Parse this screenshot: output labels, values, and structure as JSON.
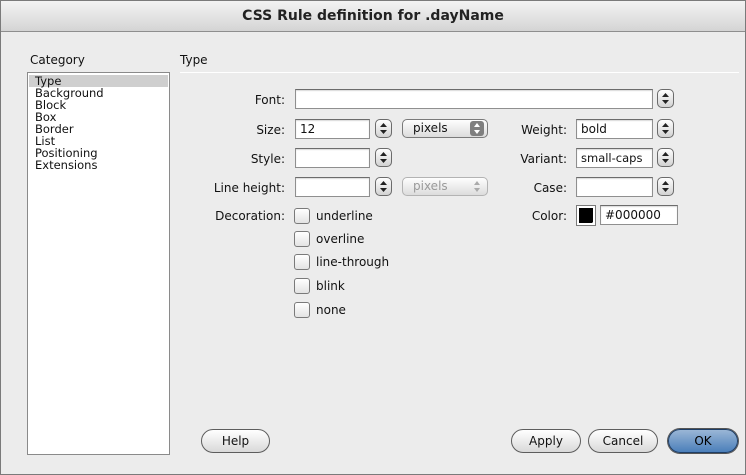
{
  "window": {
    "title": "CSS Rule definition for .dayName"
  },
  "category": {
    "heading": "Category",
    "items": [
      "Type",
      "Background",
      "Block",
      "Box",
      "Border",
      "List",
      "Positioning",
      "Extensions"
    ],
    "selected": "Type"
  },
  "panel": {
    "heading": "Type",
    "font": {
      "label": "Font:",
      "value": ""
    },
    "size": {
      "label": "Size:",
      "value": "12",
      "unit": "pixels"
    },
    "weight": {
      "label": "Weight:",
      "value": "bold"
    },
    "style": {
      "label": "Style:",
      "value": ""
    },
    "variant": {
      "label": "Variant:",
      "value": "small-caps"
    },
    "line_height": {
      "label": "Line height:",
      "value": "",
      "unit": "pixels"
    },
    "case": {
      "label": "Case:",
      "value": ""
    },
    "decoration": {
      "label": "Decoration:",
      "options": [
        "underline",
        "overline",
        "line-through",
        "blink",
        "none"
      ]
    },
    "color": {
      "label": "Color:",
      "value": "#000000",
      "swatch": "#000000"
    }
  },
  "buttons": {
    "help": "Help",
    "apply": "Apply",
    "cancel": "Cancel",
    "ok": "OK"
  },
  "icons": {
    "stepper": "up-down-arrows-icon",
    "popup": "popup-arrows-icon"
  }
}
